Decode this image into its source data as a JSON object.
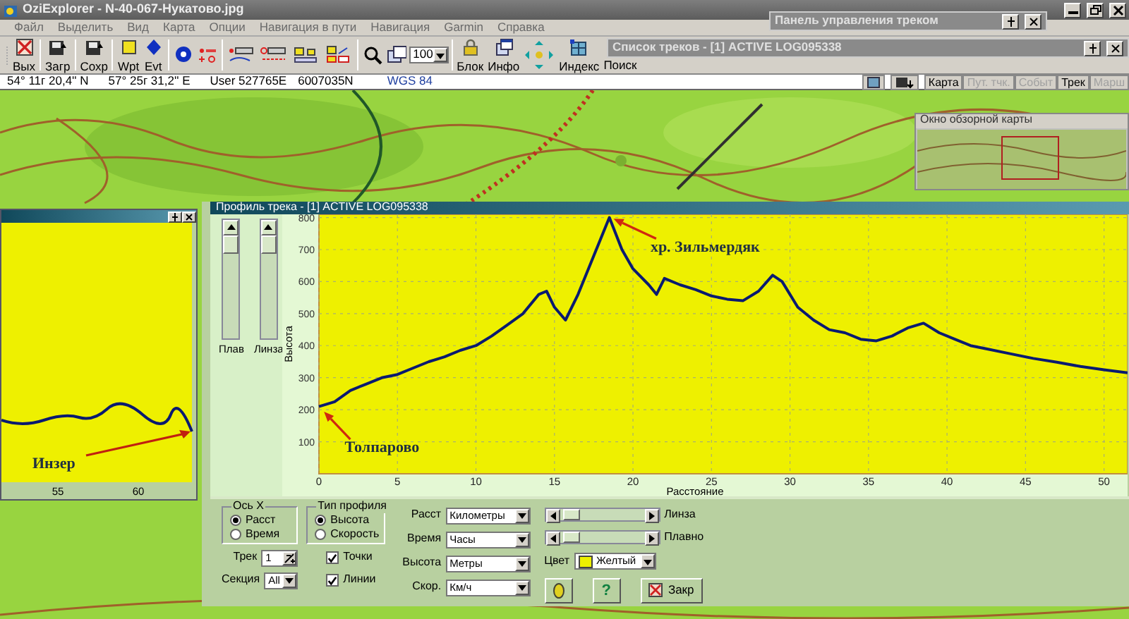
{
  "window": {
    "title": "OziExplorer - N-40-067-Нукатово.jpg"
  },
  "menu": [
    "Файл",
    "Выделить",
    "Вид",
    "Карта",
    "Опции",
    "Навигация в пути",
    "Навигация",
    "Garmin",
    "Справка"
  ],
  "toolbar": [
    {
      "kind": "button",
      "label": "Вых"
    },
    {
      "kind": "button",
      "label": "Загр"
    },
    {
      "kind": "button",
      "label": "Сохр"
    },
    {
      "kind": "button",
      "label": "Wpt"
    },
    {
      "kind": "button",
      "label": "Evt"
    },
    {
      "kind": "tools"
    },
    {
      "kind": "zoom",
      "value": "100"
    },
    {
      "kind": "button",
      "label": "Блок"
    },
    {
      "kind": "button",
      "label": "Инфо"
    },
    {
      "kind": "arrows"
    },
    {
      "kind": "button",
      "label": "Индекс"
    },
    {
      "kind": "button",
      "label": "Поиск"
    }
  ],
  "track_panel": {
    "title": "Панель управления треком"
  },
  "track_list": {
    "title": "Список треков - [1] ACTIVE LOG095338"
  },
  "coords": {
    "lat": "54° 11г 20,4'' N",
    "lon": "57° 25г 31,2'' E",
    "grid": "User 527765E",
    "northing": "6007035N",
    "datum": "WGS 84"
  },
  "layer_buttons": [
    {
      "label": "Карта",
      "disabled": false
    },
    {
      "label": "Пут. тчк.",
      "disabled": true
    },
    {
      "label": "Событ",
      "disabled": true
    },
    {
      "label": "Трек",
      "disabled": false
    },
    {
      "label": "Марш",
      "disabled": true
    }
  ],
  "overview": {
    "title": "Окно обзорной карты"
  },
  "left_profile": {
    "x_tick_labels": [
      "55",
      "60"
    ],
    "annotation": "Инзер"
  },
  "profile": {
    "title": "Профиль трека - [1] ACTIVE LOG095338",
    "sliders": [
      {
        "label": "Плав"
      },
      {
        "label": "Линза"
      }
    ],
    "chart_data": {
      "type": "line",
      "xlabel": "Расстояние",
      "ylabel": "Высота",
      "xlim": [
        0,
        51.5
      ],
      "ylim": [
        0,
        810
      ],
      "grid": true,
      "xticks": [
        0,
        5,
        10,
        15,
        20,
        25,
        30,
        35,
        40,
        45,
        50
      ],
      "yticks": [
        100,
        200,
        300,
        400,
        500,
        600,
        700,
        800
      ],
      "x": [
        0,
        1,
        2,
        3,
        4,
        5,
        6,
        7,
        8,
        9,
        10,
        11,
        12,
        13,
        14,
        14.5,
        15,
        15.7,
        16.5,
        17.5,
        18.5,
        19.3,
        20,
        21,
        21.5,
        22,
        23,
        24,
        25,
        26,
        27,
        28,
        28.9,
        29.5,
        30.5,
        31.5,
        32.5,
        33.5,
        34.5,
        35.5,
        36.5,
        37.5,
        38.5,
        39.5,
        40.5,
        41.5,
        42.5,
        44,
        45.5,
        47,
        48.5,
        50,
        51.5
      ],
      "series": [
        {
          "color": "#0a1a70",
          "values": [
            210,
            225,
            260,
            280,
            300,
            310,
            330,
            350,
            365,
            385,
            400,
            430,
            465,
            500,
            560,
            570,
            520,
            480,
            560,
            680,
            800,
            700,
            640,
            590,
            560,
            610,
            590,
            575,
            555,
            545,
            540,
            570,
            620,
            600,
            520,
            480,
            450,
            440,
            420,
            415,
            430,
            455,
            470,
            440,
            420,
            400,
            390,
            375,
            360,
            348,
            335,
            325,
            315
          ]
        }
      ],
      "annotations": [
        {
          "text": "хр. Зильмердяк",
          "x": 18.6,
          "y": 800
        },
        {
          "text": "Толпарово",
          "x": 0.2,
          "y": 200
        }
      ]
    },
    "controls": {
      "x_axis": {
        "title": "Ось X",
        "options": [
          {
            "label": "Расст",
            "selected": true
          },
          {
            "label": "Время",
            "selected": false
          }
        ]
      },
      "profile_type": {
        "title": "Тип профиля",
        "options": [
          {
            "label": "Высота",
            "selected": true
          },
          {
            "label": "Скорость",
            "selected": false
          }
        ]
      },
      "track": {
        "label": "Трек",
        "value": "1"
      },
      "section": {
        "label": "Секция",
        "value": "All"
      },
      "checkboxes": [
        {
          "label": "Точки",
          "checked": true
        },
        {
          "label": "Линии",
          "checked": true
        }
      ],
      "units": [
        {
          "label": "Расст",
          "value": "Километры"
        },
        {
          "label": "Время",
          "value": "Часы"
        },
        {
          "label": "Высота",
          "value": "Метры"
        },
        {
          "label": "Скор.",
          "value": "Км/ч"
        }
      ],
      "scrollbars": [
        {
          "label": "Линза"
        },
        {
          "label": "Плавно"
        }
      ],
      "color": {
        "label": "Цвет",
        "value": "Желтый",
        "color": "#eef000"
      },
      "buttons": [
        {
          "kind": "icon"
        },
        {
          "kind": "help",
          "label": "?"
        },
        {
          "kind": "close",
          "label": "Закр"
        }
      ]
    }
  }
}
